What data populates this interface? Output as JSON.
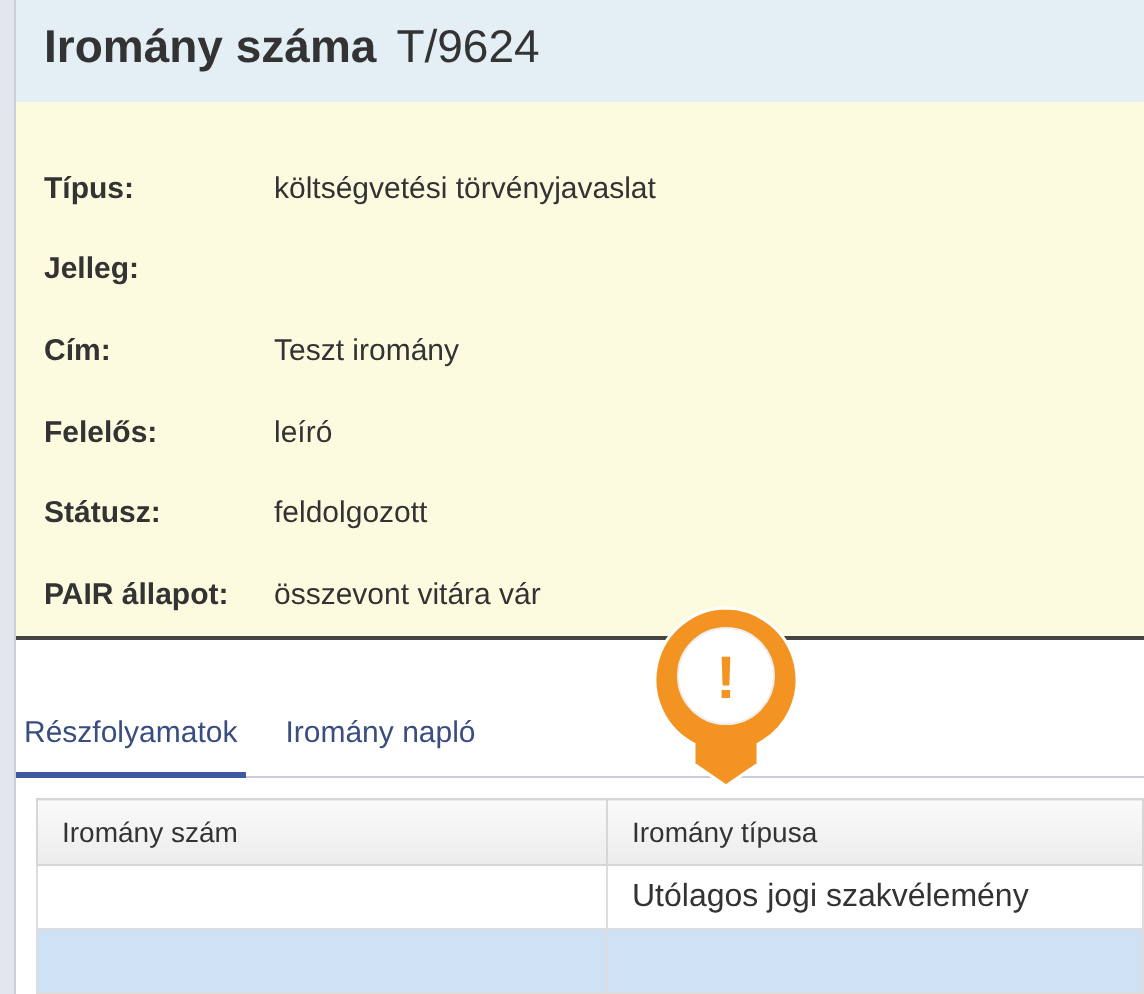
{
  "header": {
    "title": "Iromány száma",
    "number": "T/9624"
  },
  "fields": [
    {
      "label": "Típus:",
      "value": "költségvetési törvényjavaslat"
    },
    {
      "label": "Jelleg:"
    },
    {
      "label": "Cím:",
      "value": "Teszt iromány"
    },
    {
      "label": "Felelős:",
      "value": "leíró"
    },
    {
      "label": "Státusz:",
      "value": "feldolgozott"
    },
    {
      "label": "PAIR állapot:",
      "value": "összevont vitára vár"
    }
  ],
  "marker": {
    "symbol": "!"
  },
  "tabs": [
    {
      "label": "Részfolyamatok",
      "selected": true
    },
    {
      "label": "Iromány napló",
      "selected": false
    }
  ],
  "table": {
    "columns": [
      "Iromány szám",
      "Iromány típusa"
    ],
    "rows": [
      {
        "cells": [
          "",
          "Utólagos jogi szakvélemény"
        ],
        "selected": false
      },
      {
        "cells": [
          "",
          ""
        ],
        "selected": true
      }
    ]
  }
}
